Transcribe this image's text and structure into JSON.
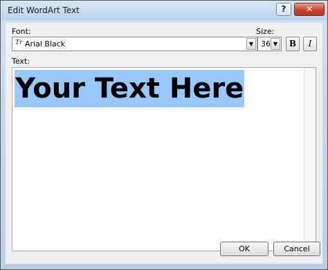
{
  "window": {
    "title": "Edit WordArt Text",
    "help_label": "?",
    "close_label": "✕"
  },
  "font": {
    "label": "Font:",
    "value": "Arial Black",
    "font_icon": "Tr"
  },
  "size": {
    "label": "Size:",
    "value": "36"
  },
  "style": {
    "bold": "B",
    "italic": "I"
  },
  "text": {
    "label": "Text:",
    "content": "Your Text Here",
    "highlight_color": "#99c7ff"
  },
  "buttons": {
    "ok": "OK",
    "cancel": "Cancel"
  },
  "icons": [
    "help-icon",
    "close-icon",
    "font-type-icon",
    "chevron-down-icon"
  ]
}
